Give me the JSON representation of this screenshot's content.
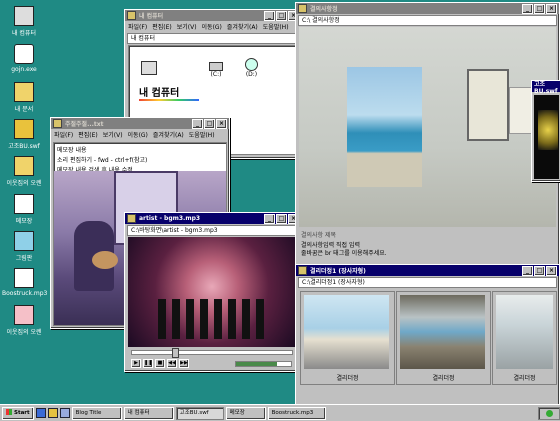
{
  "desktop_icons": [
    {
      "label": "내 컴퓨터",
      "icon": "computer-icon"
    },
    {
      "label": "gojn.exe",
      "icon": "app-icon"
    },
    {
      "label": "내 문서",
      "icon": "folder-icon"
    },
    {
      "label": "고조BU.swf",
      "icon": "media-icon"
    },
    {
      "label": "이웃집의 오렌",
      "icon": "folder-icon"
    },
    {
      "label": "메모장",
      "icon": "notepad-icon"
    },
    {
      "label": "그림판",
      "icon": "paint-icon"
    },
    {
      "label": "Boostruck.mp3",
      "icon": "audio-icon"
    },
    {
      "label": "이웃집의 오렌",
      "icon": "app-icon"
    }
  ],
  "mycomputer": {
    "title": "내 컴퓨터",
    "menu": [
      "파일(F)",
      "편집(E)",
      "보기(V)",
      "이동(G)",
      "즐겨찾기(A)",
      "도움말(H)"
    ],
    "address": "내 컴퓨터",
    "drives": [
      {
        "label": "(C:)"
      },
      {
        "label": "(D:)"
      }
    ],
    "heading": "내 컴퓨터"
  },
  "notepad": {
    "title": "주절주절...txt",
    "menu": [
      "파일(F)",
      "편집(E)",
      "보기(V)",
      "이동(G)",
      "즐겨찾기(A)",
      "도움말(H)"
    ],
    "lines": [
      "메모장 내용",
      "소리 편집하기 - fwd - ctrl+f(참고)",
      "메모장 내용 검색 후 내용 수정"
    ]
  },
  "player": {
    "title": "artist - bgm3.mp3",
    "address": "C:\\바탕화면\\artist - bgm3.mp3",
    "volume": 0.75
  },
  "explorer": {
    "title": "결의사항정",
    "address": "C:\\ 결의사항정",
    "caption": "결의사항 제목",
    "text": [
      "결의사항입력 직접 입력",
      "줄바꿈은 br 태그를 이용해주세요."
    ]
  },
  "gallery": {
    "title": "결리더정1 (장사자형)",
    "address": "C:\\결리더정1 (장사자형)",
    "thumbs": [
      {
        "label": "결리더정"
      },
      {
        "label": "결리더정"
      },
      {
        "label": "결리더정"
      }
    ]
  },
  "side_window": {
    "title": "고조BU.swf"
  },
  "taskbar": {
    "start": "Start",
    "tasks": [
      "Blog Title",
      "내 컴퓨터",
      "고조BU.swf",
      "메모장",
      "Boostruck.mp3"
    ]
  },
  "colors": {
    "desktop": "#1f8a84",
    "titlebar": "#07006b",
    "chrome": "#c0c0c0"
  }
}
